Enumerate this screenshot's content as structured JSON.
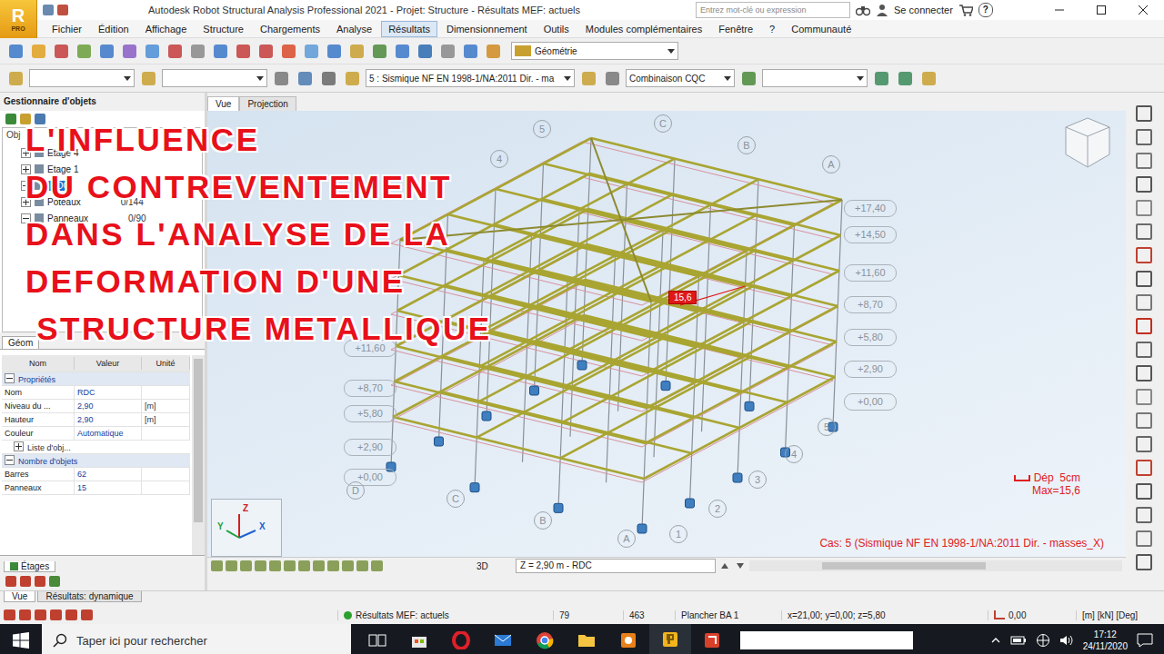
{
  "app": {
    "logo": "R",
    "edition": "PRO"
  },
  "window": {
    "title": "Autodesk Robot Structural Analysis Professional 2021 - Projet: Structure - Résultats MEF: actuels",
    "search_placeholder": "Entrez mot-clé ou expression",
    "sign_in": "Se connecter",
    "help": "?"
  },
  "menu": [
    {
      "label": "Fichier",
      "selected": false
    },
    {
      "label": "Édition",
      "selected": false
    },
    {
      "label": "Affichage",
      "selected": false
    },
    {
      "label": "Structure",
      "selected": false
    },
    {
      "label": "Chargements",
      "selected": false
    },
    {
      "label": "Analyse",
      "selected": false
    },
    {
      "label": "Résultats",
      "selected": true
    },
    {
      "label": "Dimensionnement",
      "selected": false
    },
    {
      "label": "Outils",
      "selected": false
    },
    {
      "label": "Modules complémentaires",
      "selected": false
    },
    {
      "label": "Fenêtre",
      "selected": false
    },
    {
      "label": "?",
      "selected": false
    },
    {
      "label": "Communauté",
      "selected": false
    }
  ],
  "toolbar": {
    "view_select": "Géométrie",
    "case_select": "5 : Sismique NF EN 1998-1/NA:2011 Dir. - ma",
    "combination_select": "Combinaison CQC"
  },
  "object_manager": {
    "title": "Gestionnaire d'objets",
    "tree_label": "Obj",
    "tree": [
      {
        "label": "Etage 4",
        "count": "",
        "indent": 1,
        "expanded": false,
        "selected": false
      },
      {
        "label": "Etage 1",
        "count": "",
        "indent": 1,
        "expanded": false,
        "selected": false
      },
      {
        "label": "RDC",
        "count": "",
        "indent": 1,
        "expanded": false,
        "selected": true
      },
      {
        "label": "Poteaux",
        "count": "0/144",
        "indent": 1,
        "expanded": false,
        "selected": false
      },
      {
        "label": "Panneaux",
        "count": "0/90",
        "indent": 1,
        "expanded": true,
        "selected": false
      }
    ],
    "properties_tab": "Géom",
    "columns": [
      "Nom",
      "Valeur",
      "Unité"
    ],
    "rows": [
      {
        "kind": "group",
        "name": "Propriétés",
        "value": "",
        "unit": "",
        "expanded": true
      },
      {
        "kind": "row",
        "name": "Nom",
        "value": "RDC",
        "unit": "",
        "expanded": false
      },
      {
        "kind": "row",
        "name": "Niveau du ...",
        "value": "2,90",
        "unit": "[m]",
        "expanded": false
      },
      {
        "kind": "row",
        "name": "Hauteur",
        "value": "2,90",
        "unit": "[m]",
        "expanded": false
      },
      {
        "kind": "row",
        "name": "Couleur",
        "value": "Automatique",
        "unit": "",
        "expanded": false
      },
      {
        "kind": "subgroup",
        "name": "Liste d'obj...",
        "value": "",
        "unit": "",
        "expanded": false
      },
      {
        "kind": "group",
        "name": "Nombre d'objets",
        "value": "",
        "unit": "",
        "expanded": true
      },
      {
        "kind": "row",
        "name": "Barres",
        "value": "62",
        "unit": "",
        "expanded": false
      },
      {
        "kind": "row",
        "name": "Panneaux",
        "value": "15",
        "unit": "",
        "expanded": false
      }
    ],
    "floors_tab": "Étages"
  },
  "view": {
    "tabs": [
      {
        "label": "Vue",
        "selected": true
      },
      {
        "label": "Projection",
        "selected": false
      }
    ],
    "levels_right": [
      "+17,40",
      "+14,50",
      "+11,60",
      "+8,70",
      "+5,80",
      "+2,90",
      "+0,00"
    ],
    "levels_left": [
      "+11,60",
      "+8,70",
      "+5,80",
      "+2,90",
      "+0,00"
    ],
    "grid_top": [
      "5",
      "4",
      "C",
      "B",
      "A"
    ],
    "grid_bottom": [
      "5",
      "4",
      "3",
      "2",
      "1",
      "A",
      "B",
      "C",
      "D"
    ],
    "marker": "15,6",
    "legend": {
      "scale": "Dép  5cm",
      "max": "Max=15,6"
    },
    "case": "Cas: 5 (Sismique NF EN 1998-1/NA:2011 Dir. - masses_X)",
    "axes": [
      "Z",
      "X",
      "Y"
    ],
    "mode": "3D",
    "level_field": "Z = 2,90 m - RDC"
  },
  "overlay_title": [
    "L'INFLUENCE",
    "DU CONTREVENTEMENT",
    "DANS L'ANALYSE DE LA",
    "DEFORMATION D'UNE",
    " STRUCTURE METALLIQUE"
  ],
  "bottom_tabs": [
    {
      "label": "Vue",
      "selected": true
    },
    {
      "label": "Résultats: dynamique",
      "selected": false
    }
  ],
  "status_bar": [
    {
      "kind": "indicator",
      "text": "Résultats MEF: actuels"
    },
    {
      "kind": "text",
      "text": "79"
    },
    {
      "kind": "text",
      "text": "463"
    },
    {
      "kind": "text",
      "text": "Plancher BA 1"
    },
    {
      "kind": "text",
      "text": "x=21,00; y=0,00; z=5,80"
    },
    {
      "kind": "icon-text",
      "text": "0,00"
    },
    {
      "kind": "text",
      "text": "[m] [kN] [Deg]"
    }
  ],
  "taskbar": {
    "search_placeholder": "Taper ici pour rechercher",
    "time": "17:12",
    "date": "24/11/2020"
  }
}
